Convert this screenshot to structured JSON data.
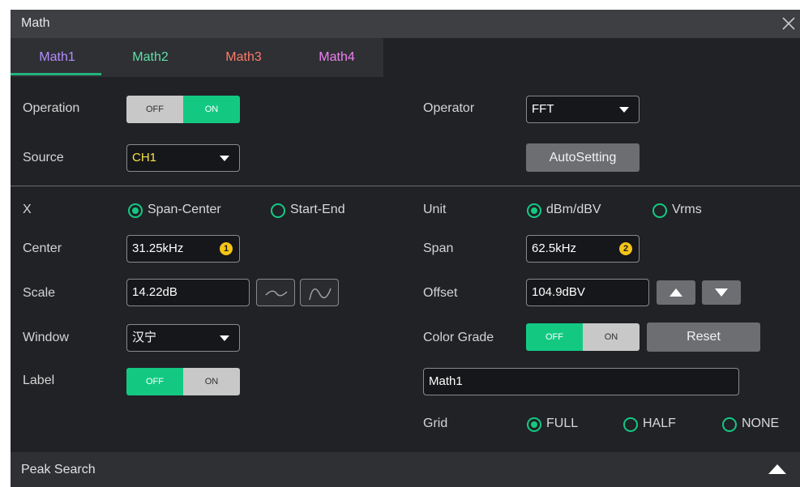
{
  "title": "Math",
  "tabs": [
    {
      "label": "Math1",
      "color": "#b58cff"
    },
    {
      "label": "Math2",
      "color": "#5fe0a8"
    },
    {
      "label": "Math3",
      "color": "#ff7a6a"
    },
    {
      "label": "Math4",
      "color": "#f080f0"
    }
  ],
  "active_tab": "Math1",
  "operation": {
    "label": "Operation",
    "off": "OFF",
    "on": "ON",
    "value": "ON"
  },
  "operator": {
    "label": "Operator",
    "value": "FFT"
  },
  "source": {
    "label": "Source",
    "value": "CH1",
    "value_color": "#f5e24a"
  },
  "autosetting": {
    "label": "AutoSetting"
  },
  "x": {
    "label": "X",
    "options": [
      "Span-Center",
      "Start-End"
    ],
    "selected": "Span-Center"
  },
  "unit": {
    "label": "Unit",
    "options": [
      "dBm/dBV",
      "Vrms"
    ],
    "selected": "dBm/dBV"
  },
  "center": {
    "label": "Center",
    "value": "31.25kHz",
    "badge": "1"
  },
  "span": {
    "label": "Span",
    "value": "62.5kHz",
    "badge": "2"
  },
  "scale": {
    "label": "Scale",
    "value": "14.22dB",
    "icons": [
      "wave-flat-icon",
      "wave-curve-icon"
    ]
  },
  "offset": {
    "label": "Offset",
    "value": "104.9dBV",
    "icons": [
      "arrow-up-icon",
      "arrow-down-icon"
    ]
  },
  "window": {
    "label": "Window",
    "value": "汉宁"
  },
  "color_grade": {
    "label": "Color Grade",
    "off": "OFF",
    "on": "ON",
    "value": "OFF",
    "reset_label": "Reset"
  },
  "label_row": {
    "label": "Label",
    "off": "OFF",
    "on": "ON",
    "value": "OFF",
    "text_value": "Math1"
  },
  "grid": {
    "label": "Grid",
    "options": [
      "FULL",
      "HALF",
      "NONE"
    ],
    "selected": "FULL"
  },
  "peak_search": {
    "label": "Peak Search"
  },
  "colors": {
    "accent": "#13c982",
    "badge": "#f5c518",
    "background": "#202226"
  }
}
